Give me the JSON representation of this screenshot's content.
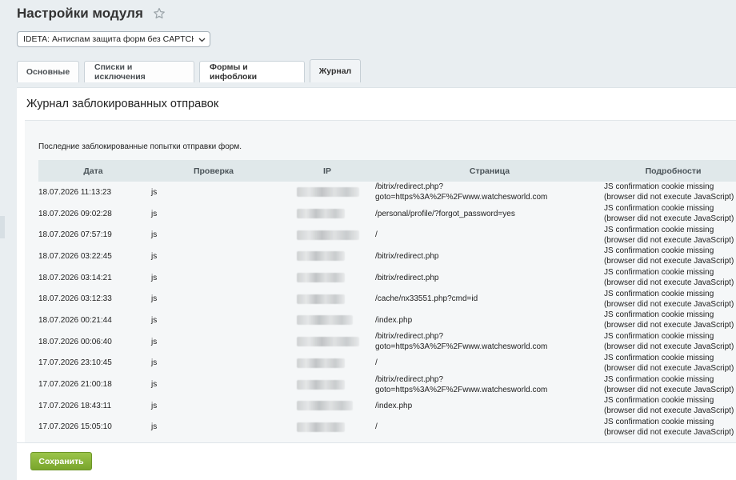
{
  "header": {
    "title": "Настройки модуля"
  },
  "module_select": {
    "value": "IDETA: Антиспам защита форм без CAPTCHA"
  },
  "tabs": [
    {
      "label": "Основные"
    },
    {
      "label": "Списки и исключения"
    },
    {
      "label": "Формы и инфоблоки"
    },
    {
      "label": "Журнал"
    }
  ],
  "panel": {
    "title": "Журнал заблокированных отправок",
    "note": "Последние заблокированные попытки отправки форм."
  },
  "table": {
    "columns": {
      "date": "Дата",
      "check": "Проверка",
      "ip": "IP",
      "page": "Страница",
      "details": "Подробности"
    },
    "rows": [
      {
        "date": "18.07.2026 11:13:23",
        "check": "js",
        "page": "/bitrix/redirect.php?\ngoto=https%3A%2F%2Fwww.watchesworld.com",
        "details": "JS confirmation cookie missing\n(browser did not execute JavaScript)"
      },
      {
        "date": "18.07.2026 09:02:28",
        "check": "js",
        "page": "/personal/profile/?forgot_password=yes",
        "details": "JS confirmation cookie missing\n(browser did not execute JavaScript)"
      },
      {
        "date": "18.07.2026 07:57:19",
        "check": "js",
        "page": "/",
        "details": "JS confirmation cookie missing\n(browser did not execute JavaScript)"
      },
      {
        "date": "18.07.2026 03:22:45",
        "check": "js",
        "page": "/bitrix/redirect.php",
        "details": "JS confirmation cookie missing\n(browser did not execute JavaScript)"
      },
      {
        "date": "18.07.2026 03:14:21",
        "check": "js",
        "page": "/bitrix/redirect.php",
        "details": "JS confirmation cookie missing\n(browser did not execute JavaScript)"
      },
      {
        "date": "18.07.2026 03:12:33",
        "check": "js",
        "page": "/cache/nx33551.php?cmd=id",
        "details": "JS confirmation cookie missing\n(browser did not execute JavaScript)"
      },
      {
        "date": "18.07.2026 00:21:44",
        "check": "js",
        "page": "/index.php",
        "details": "JS confirmation cookie missing\n(browser did not execute JavaScript)"
      },
      {
        "date": "18.07.2026 00:06:40",
        "check": "js",
        "page": "/bitrix/redirect.php?\ngoto=https%3A%2F%2Fwww.watchesworld.com",
        "details": "JS confirmation cookie missing\n(browser did not execute JavaScript)"
      },
      {
        "date": "17.07.2026 23:10:45",
        "check": "js",
        "page": "/",
        "details": "JS confirmation cookie missing\n(browser did not execute JavaScript)"
      },
      {
        "date": "17.07.2026 21:00:18",
        "check": "js",
        "page": "/bitrix/redirect.php?\ngoto=https%3A%2F%2Fwww.watchesworld.com",
        "details": "JS confirmation cookie missing\n(browser did not execute JavaScript)"
      },
      {
        "date": "17.07.2026 18:43:11",
        "check": "js",
        "page": "/index.php",
        "details": "JS confirmation cookie missing\n(browser did not execute JavaScript)"
      },
      {
        "date": "17.07.2026 15:05:10",
        "check": "js",
        "page": "/",
        "details": "JS confirmation cookie missing\n(browser did not execute JavaScript)"
      }
    ]
  },
  "footer": {
    "save_label": "Сохранить"
  },
  "colors": {
    "save_button": "#86b236",
    "header_row": "#e0e8ea",
    "active_tab": "#f1f4f6"
  }
}
